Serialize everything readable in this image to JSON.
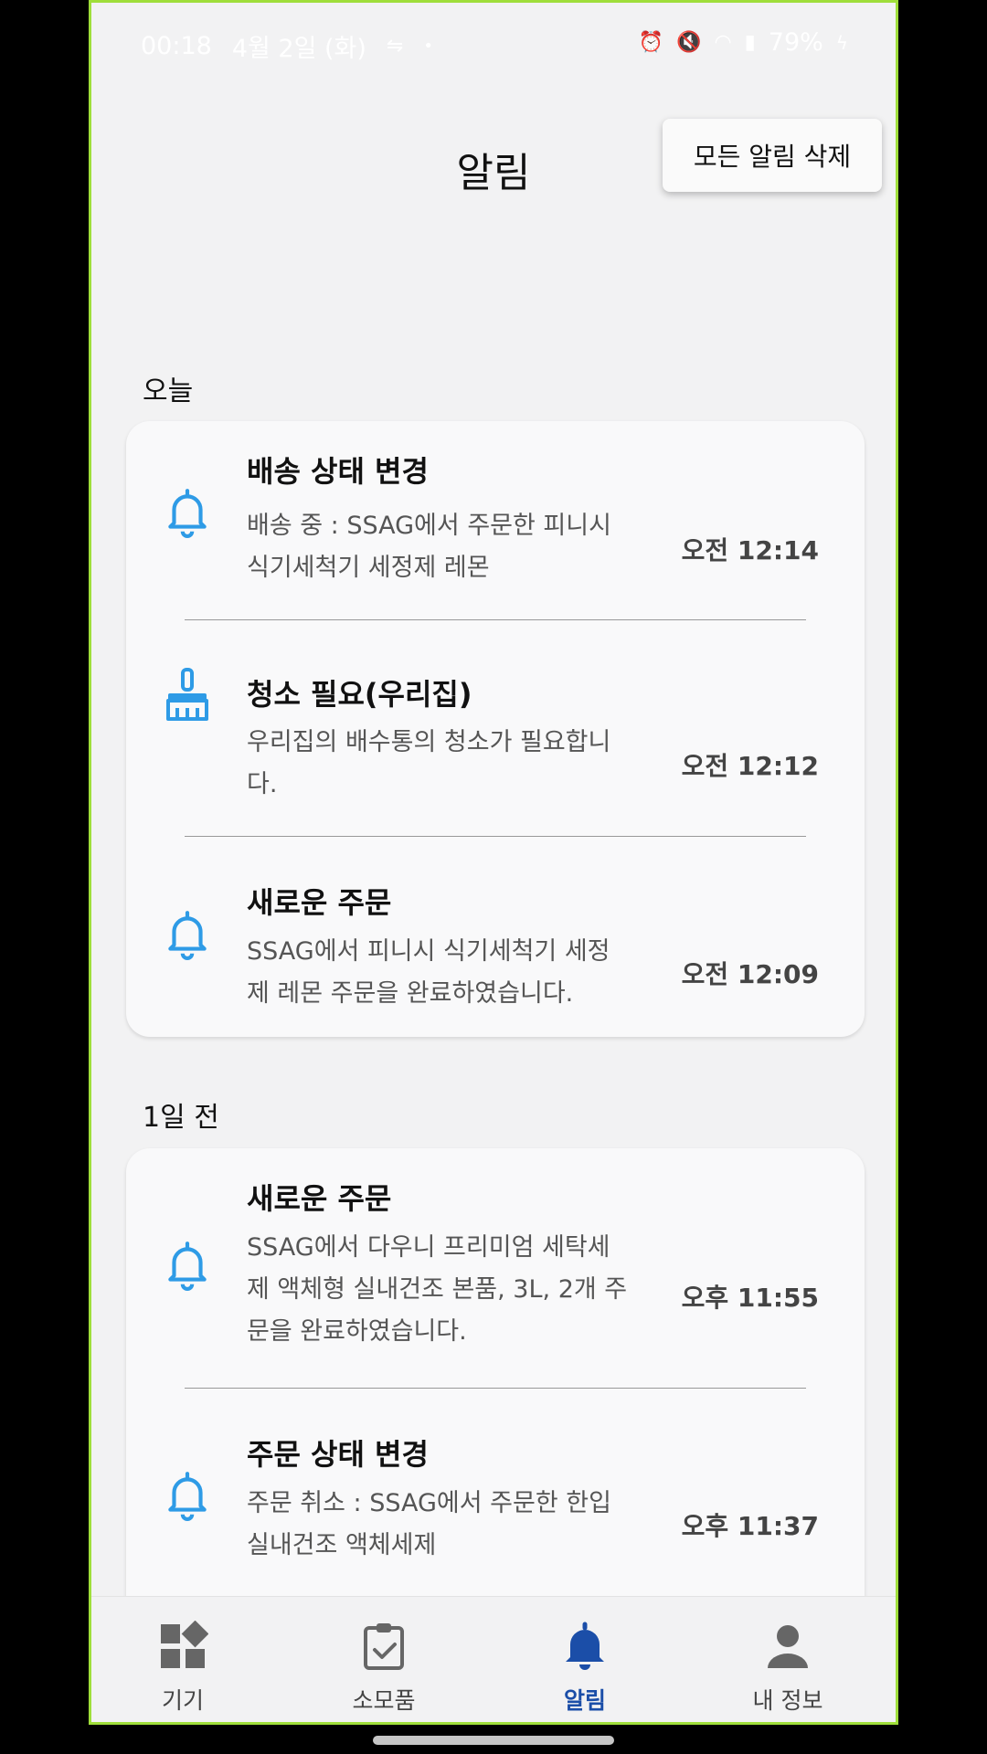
{
  "statusbar": {
    "time": "00:18",
    "date": "4월 2일 (화)",
    "battery": "79%"
  },
  "header": {
    "title": "알림",
    "delete_all": "모든 알림 삭제"
  },
  "sections": [
    {
      "label": "오늘",
      "items": [
        {
          "icon": "bell-icon",
          "title": "배송 상태 변경",
          "body1": "배송 중 : SSAG에서 주문한 피니시",
          "body2": "식기세척기 세정제 레몬",
          "body3": "",
          "time": "오전 12:14"
        },
        {
          "icon": "broom-icon",
          "title": "청소 필요(우리집)",
          "body1": "우리집의 배수통의 청소가 필요합니",
          "body2": "다.",
          "body3": "",
          "time": "오전 12:12"
        },
        {
          "icon": "bell-icon",
          "title": "새로운 주문",
          "body1": "SSAG에서 피니시 식기세척기 세정",
          "body2": "제 레몬 주문을 완료하였습니다.",
          "body3": "",
          "time": "오전 12:09"
        }
      ]
    },
    {
      "label": "1일 전",
      "items": [
        {
          "icon": "bell-icon",
          "title": "새로운 주문",
          "body1": "SSAG에서 다우니 프리미엄 세탁세",
          "body2": "제 액체형 실내건조 본품, 3L, 2개 주",
          "body3": "문을 완료하였습니다.",
          "time": "오후 11:55"
        },
        {
          "icon": "bell-icon",
          "title": "주문 상태 변경",
          "body1": "주문 취소 : SSAG에서 주문한 한입",
          "body2": "실내건조 액체세제",
          "body3": "",
          "time": "오후 11:37"
        }
      ]
    }
  ],
  "nav": {
    "items": [
      {
        "label": "기기",
        "icon": "devices-icon"
      },
      {
        "label": "소모품",
        "icon": "clipboard-check-icon"
      },
      {
        "label": "알림",
        "icon": "bell-icon"
      },
      {
        "label": "내 정보",
        "icon": "person-icon"
      }
    ],
    "active_index": 2
  },
  "colors": {
    "accent_icon": "#2e9be6",
    "nav_active": "#1b4ea8",
    "frame": "#9fde3a"
  }
}
